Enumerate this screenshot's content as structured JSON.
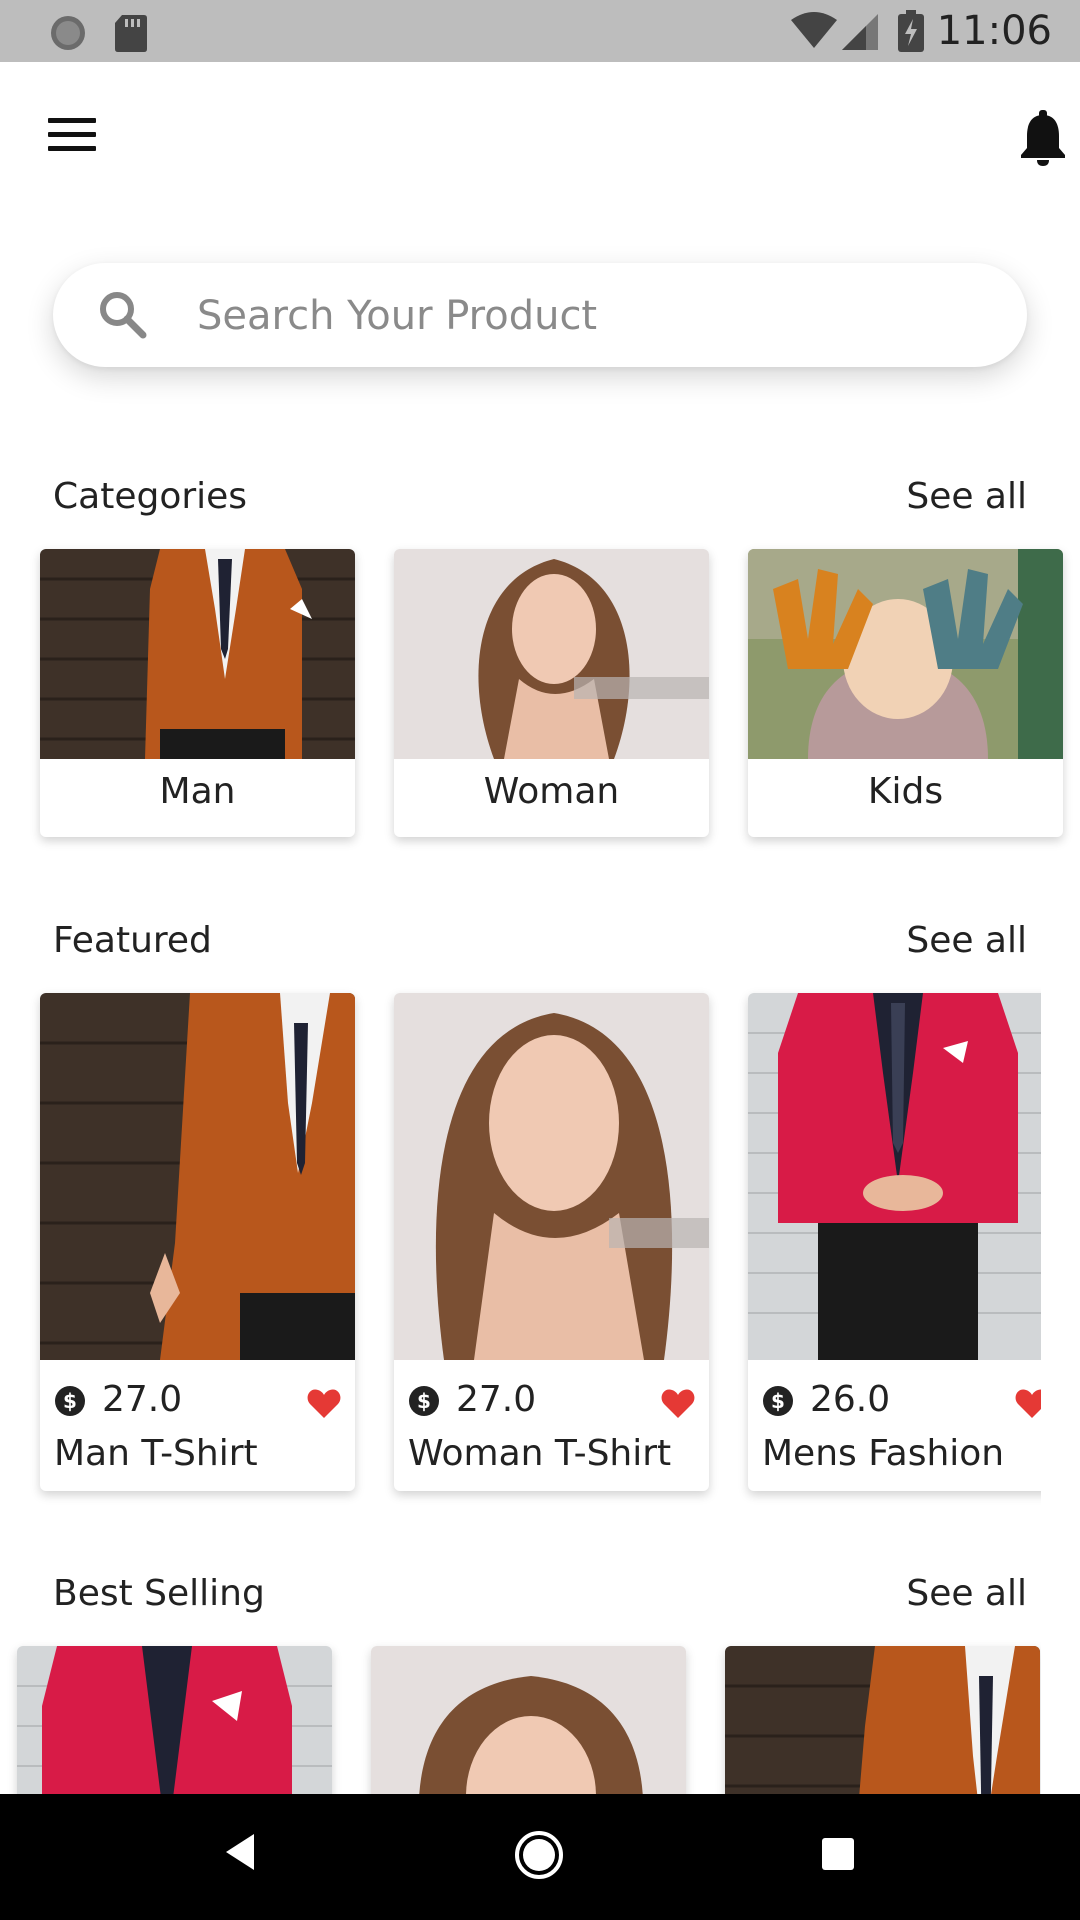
{
  "status_bar": {
    "time": "11:06",
    "icons": [
      "sync-icon",
      "sd-card-icon",
      "wifi-icon",
      "signal-icon",
      "battery-charging-icon"
    ]
  },
  "app_bar": {
    "icons": [
      "menu-icon",
      "bell-icon"
    ]
  },
  "search": {
    "placeholder": "Search Your Product",
    "value": "",
    "icon": "search-icon"
  },
  "categories": {
    "title": "Categories",
    "see_all": "See all",
    "items": [
      {
        "label": "Man"
      },
      {
        "label": "Woman"
      },
      {
        "label": "Kids"
      }
    ]
  },
  "featured": {
    "title": "Featured",
    "see_all": "See all",
    "items": [
      {
        "price": "27.0",
        "name": "Man T-Shirt"
      },
      {
        "price": "27.0",
        "name": "Woman T-Shirt"
      },
      {
        "price": "26.0",
        "name": "Mens Fashion"
      }
    ]
  },
  "best_selling": {
    "title": "Best Selling",
    "see_all": "See all"
  },
  "colors": {
    "heart": "#e53935",
    "status_bar": "#bdbdbd",
    "nav_bar": "#000000",
    "orange_jacket": "#b8571c",
    "red_jacket": "#d81b47"
  },
  "nav_bar": {
    "icons": [
      "back-icon",
      "home-icon",
      "recents-icon"
    ]
  }
}
